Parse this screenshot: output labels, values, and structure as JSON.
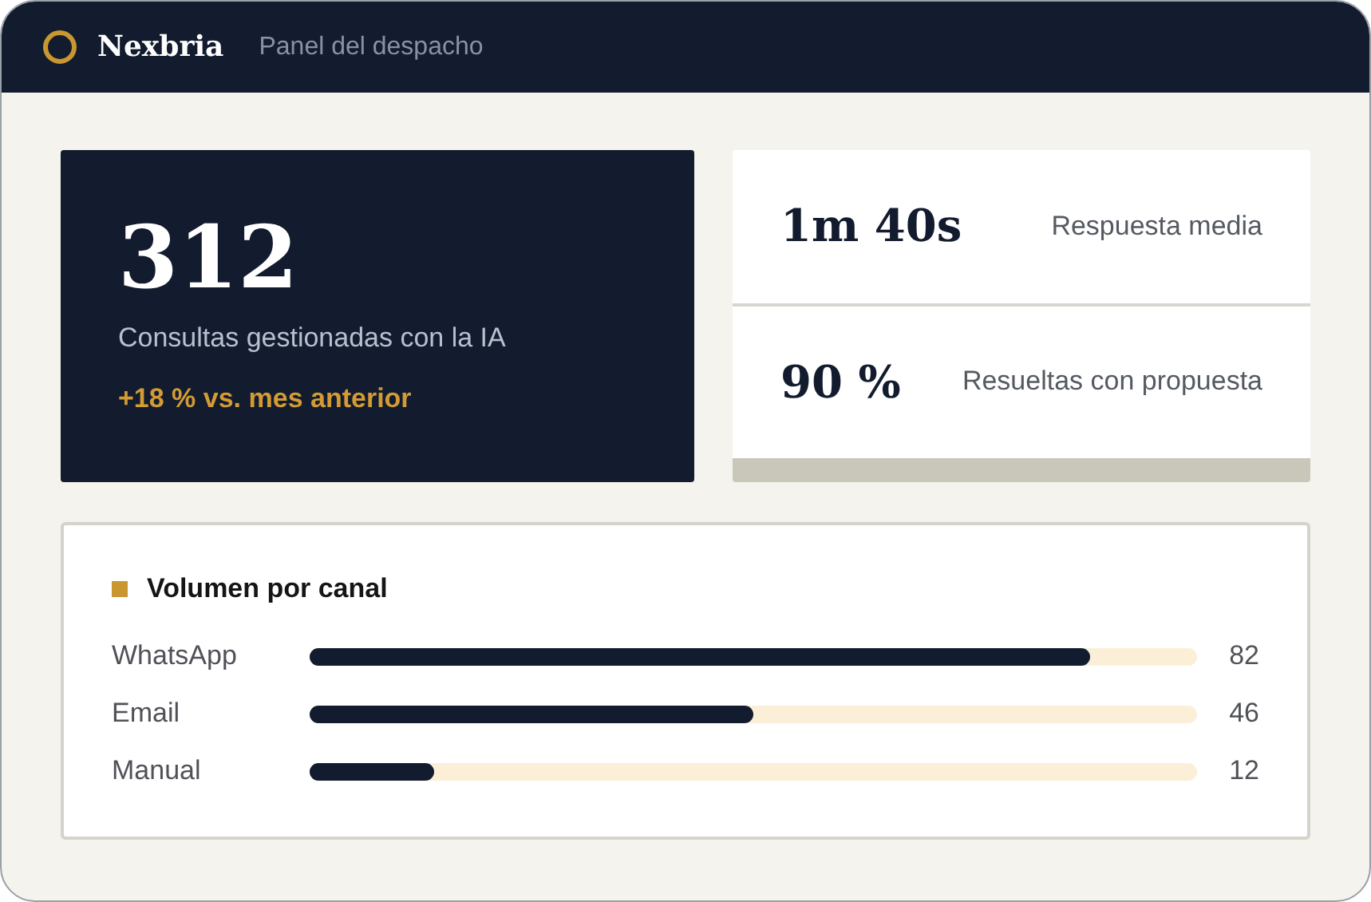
{
  "header": {
    "brand": "Nexbria",
    "subtitle": "Panel del despacho"
  },
  "hero": {
    "value": "312",
    "label": "Consultas gestionadas con la IA",
    "change": "+18 % vs. mes anterior"
  },
  "stats": [
    {
      "value": "1m 40s",
      "label": "Respuesta media"
    },
    {
      "value": "90 %",
      "label": "Resueltas con propuesta"
    }
  ],
  "channels": {
    "title": "Volumen por canal",
    "rows": [
      {
        "name": "WhatsApp",
        "level": 0.88,
        "count": "82"
      },
      {
        "name": "Email",
        "level": 0.5,
        "count": "46"
      },
      {
        "name": "Manual",
        "level": 0.14,
        "count": "12"
      }
    ]
  }
}
